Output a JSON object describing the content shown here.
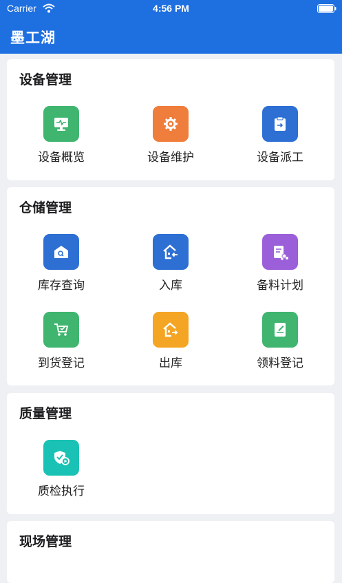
{
  "status_bar": {
    "carrier": "Carrier",
    "time": "4:56 PM"
  },
  "nav": {
    "title": "墨工湖"
  },
  "sections": [
    {
      "title": "设备管理",
      "items": [
        {
          "label": "设备概览",
          "icon": "monitor-icon",
          "color": "#3fb56f"
        },
        {
          "label": "设备维护",
          "icon": "gear-icon",
          "color": "#ef7d3b"
        },
        {
          "label": "设备派工",
          "icon": "clipboard-icon",
          "color": "#2d6fd3"
        }
      ]
    },
    {
      "title": "仓储管理",
      "items": [
        {
          "label": "库存查询",
          "icon": "warehouse-search-icon",
          "color": "#2d6fd3"
        },
        {
          "label": "入库",
          "icon": "house-in-icon",
          "color": "#2d6fd3"
        },
        {
          "label": "备料计划",
          "icon": "plan-icon",
          "color": "#9a5fd9"
        },
        {
          "label": "到货登记",
          "icon": "cart-check-icon",
          "color": "#3fb56f"
        },
        {
          "label": "出库",
          "icon": "house-out-icon",
          "color": "#f4a524"
        },
        {
          "label": "领料登记",
          "icon": "note-icon",
          "color": "#3fb56f"
        }
      ]
    },
    {
      "title": "质量管理",
      "items": [
        {
          "label": "质检执行",
          "icon": "shield-play-icon",
          "color": "#19c2b4"
        }
      ]
    },
    {
      "title": "现场管理",
      "items": []
    }
  ]
}
